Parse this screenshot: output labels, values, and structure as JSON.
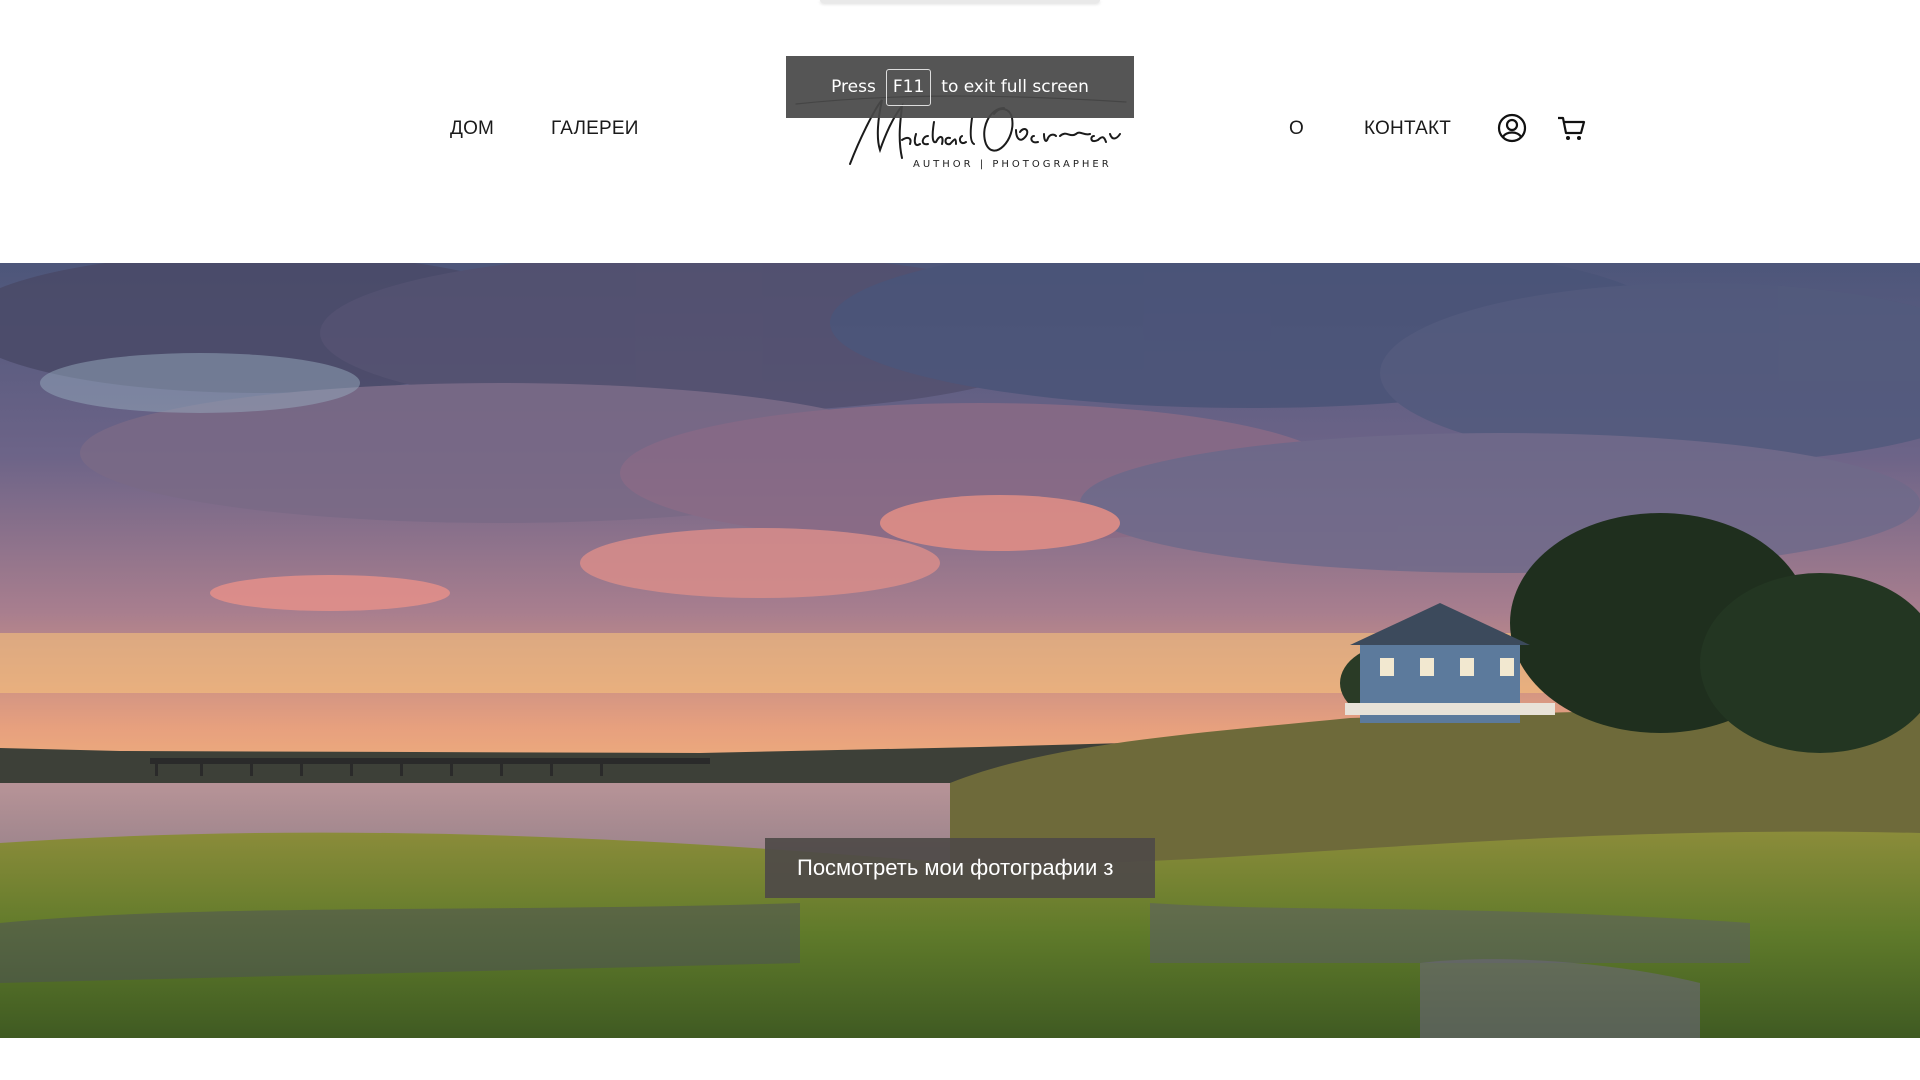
{
  "nav": {
    "home": "ДОМ",
    "galleries": "ГАЛЕРЕИ",
    "about": "О",
    "contact": "КОНТАКТ"
  },
  "logo": {
    "signature": "Michael Oberman",
    "subtitle": "AUTHOR | PHOTOGRAPHER"
  },
  "fullscreen_toast": {
    "prefix": "Press",
    "key": "F11",
    "suffix": "to exit full screen"
  },
  "hero": {
    "cta_label": "Посмотреть мои фотографии з"
  },
  "icons": {
    "account": "user-circle-icon",
    "cart": "shopping-cart-icon"
  },
  "colors": {
    "cta_bg": "#4e4a48",
    "toast_bg": "#484848"
  }
}
